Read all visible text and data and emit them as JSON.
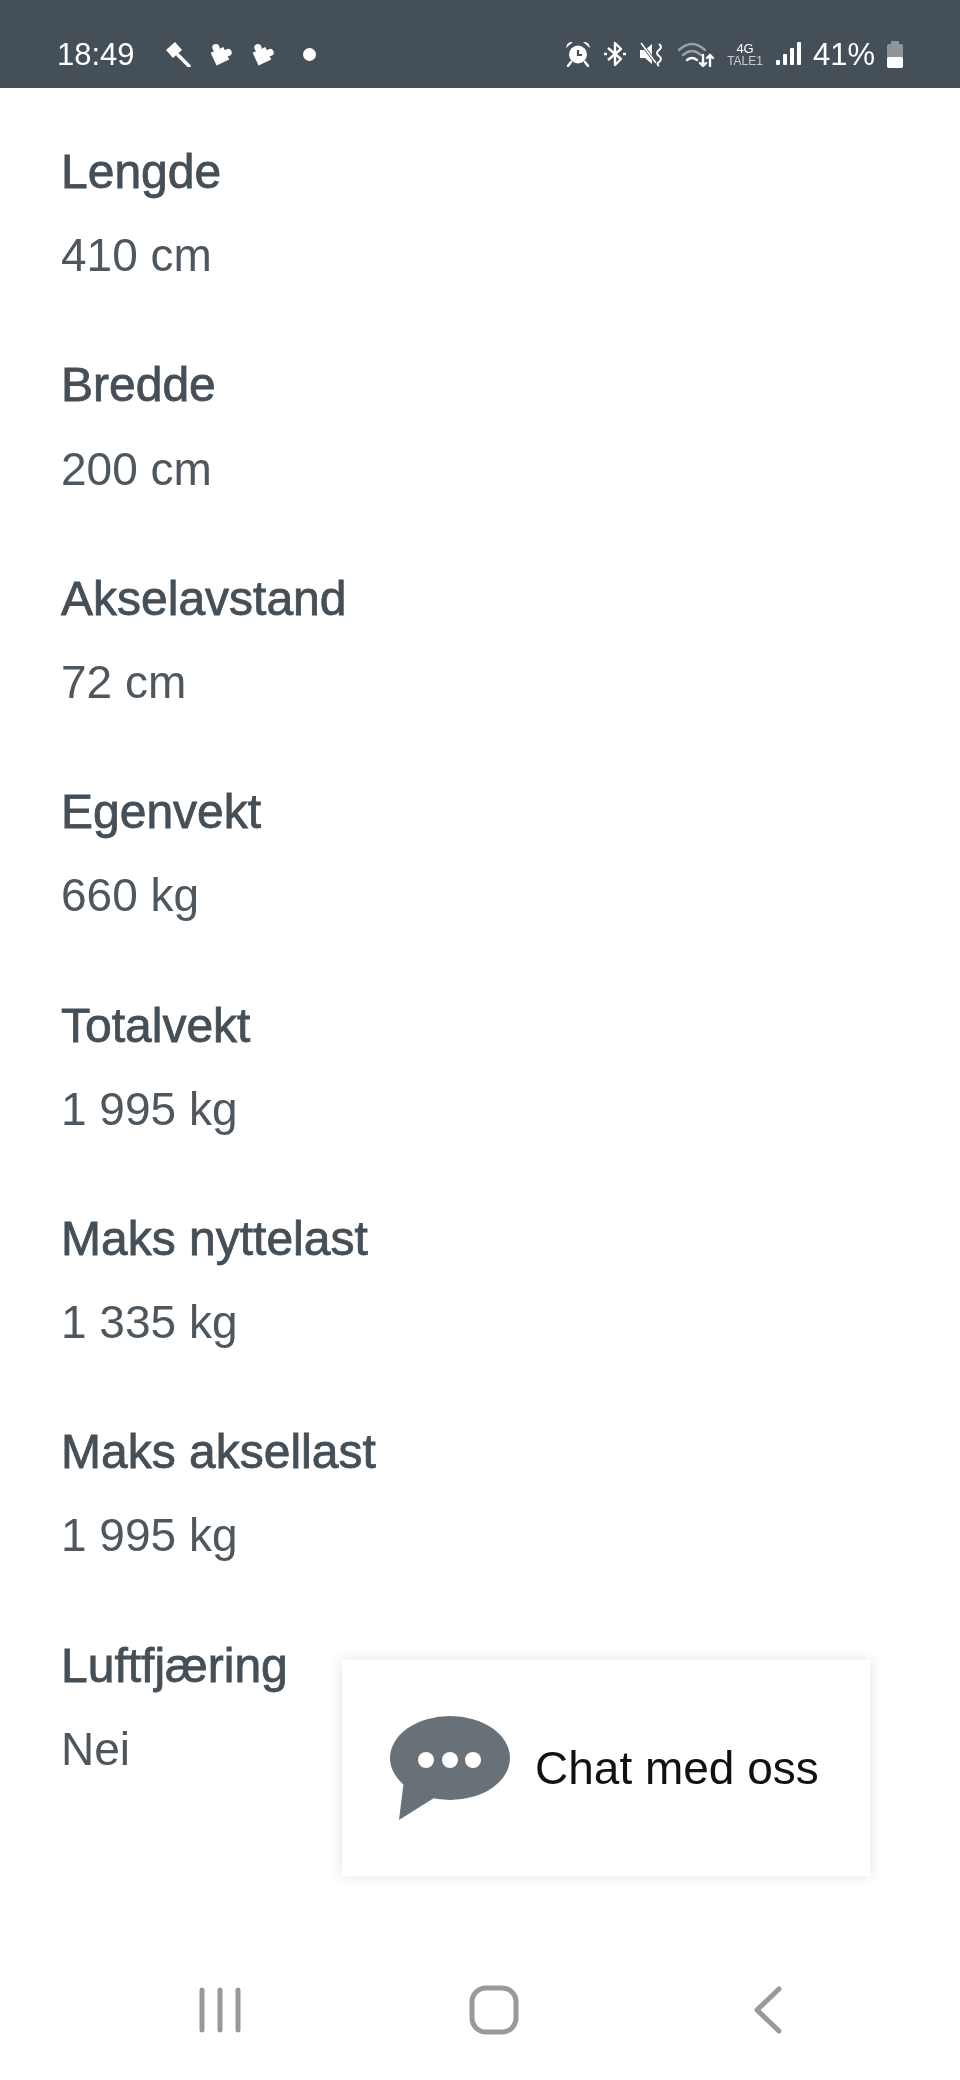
{
  "status_bar": {
    "time": "18:49",
    "network_type": "4G",
    "carrier": "TALE1",
    "battery_percent": "41%"
  },
  "specs": [
    {
      "label": "Lengde",
      "value": "410 cm"
    },
    {
      "label": "Bredde",
      "value": "200 cm"
    },
    {
      "label": "Akselavstand",
      "value": "72 cm"
    },
    {
      "label": "Egenvekt",
      "value": "660 kg"
    },
    {
      "label": "Totalvekt",
      "value": "1 995 kg"
    },
    {
      "label": "Maks nyttelast",
      "value": "1 335 kg"
    },
    {
      "label": "Maks aksellast",
      "value": "1 995 kg"
    },
    {
      "label": "Luftfjæring",
      "value": "Nei"
    }
  ],
  "chat_button": {
    "label": "Chat med oss"
  }
}
